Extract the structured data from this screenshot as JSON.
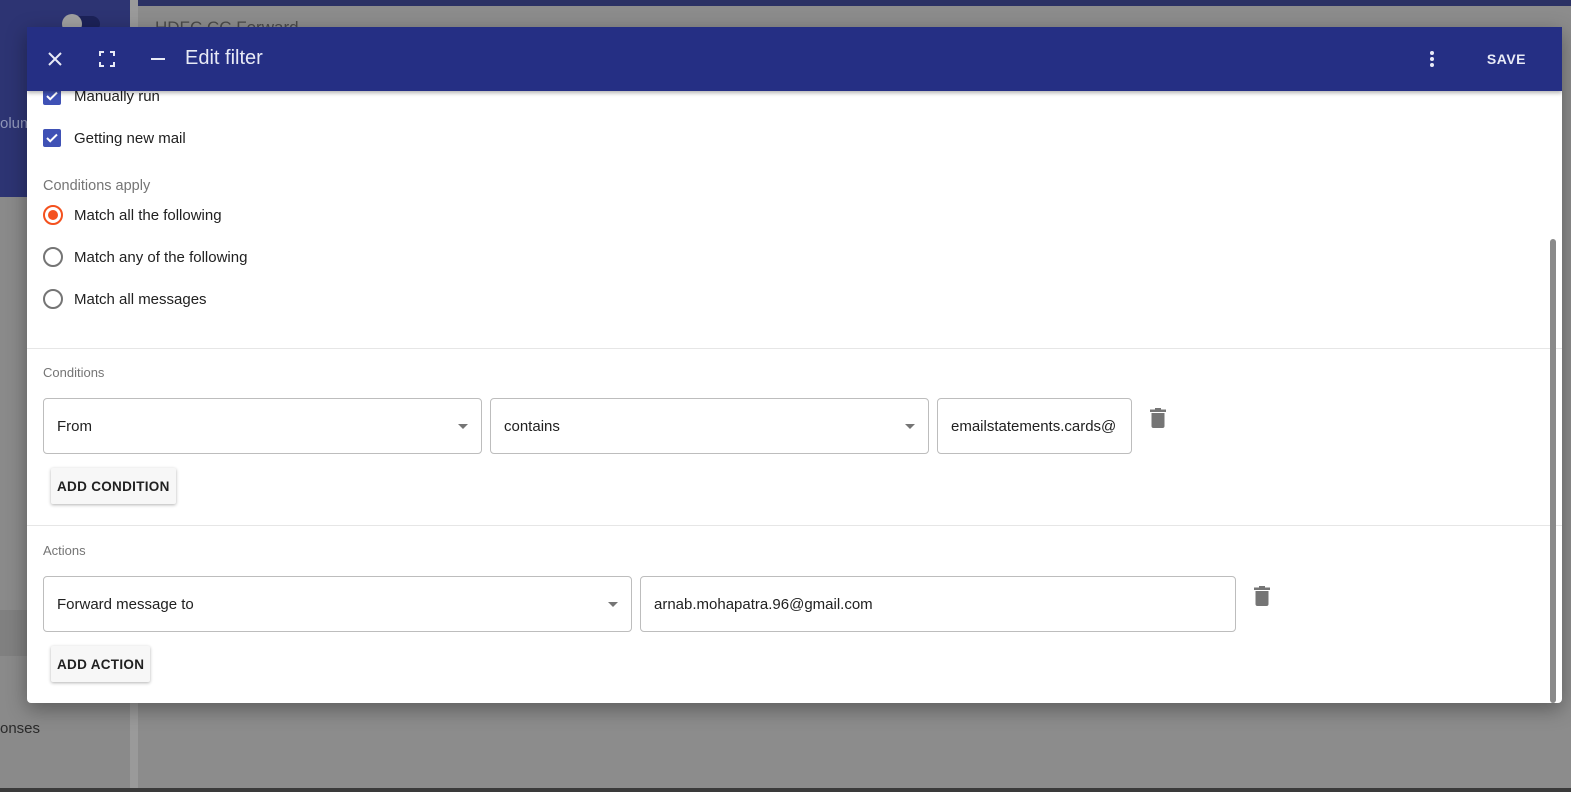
{
  "background": {
    "window_title": "HDFC CC Forward",
    "sidebar_fragment_1": "olum",
    "sidebar_fragment_2": "onses"
  },
  "dialog": {
    "title": "Edit filter",
    "save_label": "SAVE",
    "header_icons": [
      "close-icon",
      "fullscreen-icon",
      "minimize-icon",
      "more-vert-icon"
    ],
    "header_color": "#252f84",
    "run_when": [
      {
        "label": "Manually run",
        "checked": true
      },
      {
        "label": "Getting new mail",
        "checked": true
      }
    ],
    "conditions_apply": {
      "label": "Conditions apply",
      "options": [
        {
          "label": "Match all the following",
          "selected": true
        },
        {
          "label": "Match any of the following",
          "selected": false
        },
        {
          "label": "Match all messages",
          "selected": false
        }
      ]
    },
    "conditions": {
      "heading": "Conditions",
      "rows": [
        {
          "field": "From",
          "operator": "contains",
          "value": "emailstatements.cards@"
        }
      ],
      "add_label": "ADD CONDITION"
    },
    "actions": {
      "heading": "Actions",
      "rows": [
        {
          "action": "Forward message to",
          "value": "arnab.mohapatra.96@gmail.com"
        }
      ],
      "add_label": "ADD ACTION"
    }
  }
}
